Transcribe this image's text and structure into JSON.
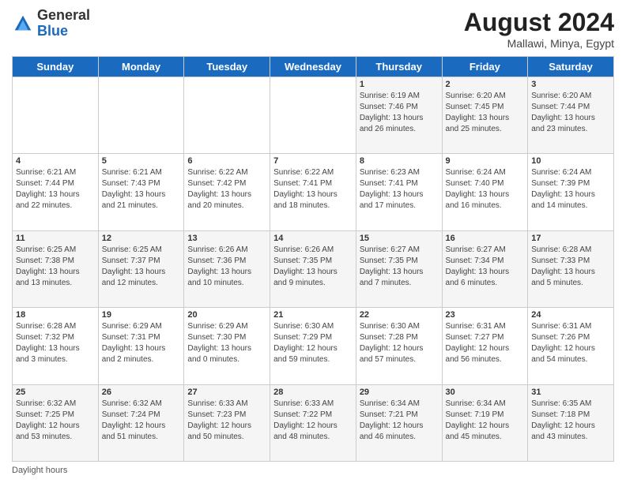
{
  "header": {
    "logo_general": "General",
    "logo_blue": "Blue",
    "month_year": "August 2024",
    "location": "Mallawi, Minya, Egypt"
  },
  "days_of_week": [
    "Sunday",
    "Monday",
    "Tuesday",
    "Wednesday",
    "Thursday",
    "Friday",
    "Saturday"
  ],
  "weeks": [
    [
      {
        "day": "",
        "detail": ""
      },
      {
        "day": "",
        "detail": ""
      },
      {
        "day": "",
        "detail": ""
      },
      {
        "day": "",
        "detail": ""
      },
      {
        "day": "1",
        "detail": "Sunrise: 6:19 AM\nSunset: 7:46 PM\nDaylight: 13 hours\nand 26 minutes."
      },
      {
        "day": "2",
        "detail": "Sunrise: 6:20 AM\nSunset: 7:45 PM\nDaylight: 13 hours\nand 25 minutes."
      },
      {
        "day": "3",
        "detail": "Sunrise: 6:20 AM\nSunset: 7:44 PM\nDaylight: 13 hours\nand 23 minutes."
      }
    ],
    [
      {
        "day": "4",
        "detail": "Sunrise: 6:21 AM\nSunset: 7:44 PM\nDaylight: 13 hours\nand 22 minutes."
      },
      {
        "day": "5",
        "detail": "Sunrise: 6:21 AM\nSunset: 7:43 PM\nDaylight: 13 hours\nand 21 minutes."
      },
      {
        "day": "6",
        "detail": "Sunrise: 6:22 AM\nSunset: 7:42 PM\nDaylight: 13 hours\nand 20 minutes."
      },
      {
        "day": "7",
        "detail": "Sunrise: 6:22 AM\nSunset: 7:41 PM\nDaylight: 13 hours\nand 18 minutes."
      },
      {
        "day": "8",
        "detail": "Sunrise: 6:23 AM\nSunset: 7:41 PM\nDaylight: 13 hours\nand 17 minutes."
      },
      {
        "day": "9",
        "detail": "Sunrise: 6:24 AM\nSunset: 7:40 PM\nDaylight: 13 hours\nand 16 minutes."
      },
      {
        "day": "10",
        "detail": "Sunrise: 6:24 AM\nSunset: 7:39 PM\nDaylight: 13 hours\nand 14 minutes."
      }
    ],
    [
      {
        "day": "11",
        "detail": "Sunrise: 6:25 AM\nSunset: 7:38 PM\nDaylight: 13 hours\nand 13 minutes."
      },
      {
        "day": "12",
        "detail": "Sunrise: 6:25 AM\nSunset: 7:37 PM\nDaylight: 13 hours\nand 12 minutes."
      },
      {
        "day": "13",
        "detail": "Sunrise: 6:26 AM\nSunset: 7:36 PM\nDaylight: 13 hours\nand 10 minutes."
      },
      {
        "day": "14",
        "detail": "Sunrise: 6:26 AM\nSunset: 7:35 PM\nDaylight: 13 hours\nand 9 minutes."
      },
      {
        "day": "15",
        "detail": "Sunrise: 6:27 AM\nSunset: 7:35 PM\nDaylight: 13 hours\nand 7 minutes."
      },
      {
        "day": "16",
        "detail": "Sunrise: 6:27 AM\nSunset: 7:34 PM\nDaylight: 13 hours\nand 6 minutes."
      },
      {
        "day": "17",
        "detail": "Sunrise: 6:28 AM\nSunset: 7:33 PM\nDaylight: 13 hours\nand 5 minutes."
      }
    ],
    [
      {
        "day": "18",
        "detail": "Sunrise: 6:28 AM\nSunset: 7:32 PM\nDaylight: 13 hours\nand 3 minutes."
      },
      {
        "day": "19",
        "detail": "Sunrise: 6:29 AM\nSunset: 7:31 PM\nDaylight: 13 hours\nand 2 minutes."
      },
      {
        "day": "20",
        "detail": "Sunrise: 6:29 AM\nSunset: 7:30 PM\nDaylight: 13 hours\nand 0 minutes."
      },
      {
        "day": "21",
        "detail": "Sunrise: 6:30 AM\nSunset: 7:29 PM\nDaylight: 12 hours\nand 59 minutes."
      },
      {
        "day": "22",
        "detail": "Sunrise: 6:30 AM\nSunset: 7:28 PM\nDaylight: 12 hours\nand 57 minutes."
      },
      {
        "day": "23",
        "detail": "Sunrise: 6:31 AM\nSunset: 7:27 PM\nDaylight: 12 hours\nand 56 minutes."
      },
      {
        "day": "24",
        "detail": "Sunrise: 6:31 AM\nSunset: 7:26 PM\nDaylight: 12 hours\nand 54 minutes."
      }
    ],
    [
      {
        "day": "25",
        "detail": "Sunrise: 6:32 AM\nSunset: 7:25 PM\nDaylight: 12 hours\nand 53 minutes."
      },
      {
        "day": "26",
        "detail": "Sunrise: 6:32 AM\nSunset: 7:24 PM\nDaylight: 12 hours\nand 51 minutes."
      },
      {
        "day": "27",
        "detail": "Sunrise: 6:33 AM\nSunset: 7:23 PM\nDaylight: 12 hours\nand 50 minutes."
      },
      {
        "day": "28",
        "detail": "Sunrise: 6:33 AM\nSunset: 7:22 PM\nDaylight: 12 hours\nand 48 minutes."
      },
      {
        "day": "29",
        "detail": "Sunrise: 6:34 AM\nSunset: 7:21 PM\nDaylight: 12 hours\nand 46 minutes."
      },
      {
        "day": "30",
        "detail": "Sunrise: 6:34 AM\nSunset: 7:19 PM\nDaylight: 12 hours\nand 45 minutes."
      },
      {
        "day": "31",
        "detail": "Sunrise: 6:35 AM\nSunset: 7:18 PM\nDaylight: 12 hours\nand 43 minutes."
      }
    ]
  ],
  "footer": {
    "daylight_label": "Daylight hours"
  }
}
